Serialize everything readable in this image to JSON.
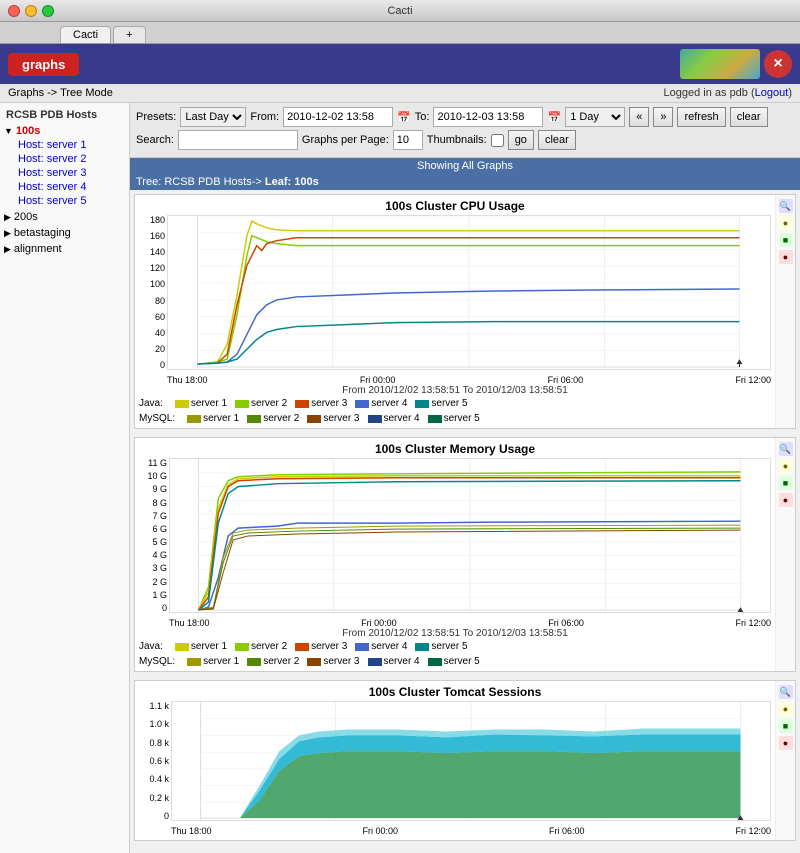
{
  "window": {
    "title": "Cacti",
    "tab_label": "Cacti"
  },
  "topbar": {
    "graphs_btn": "graphs",
    "logo_alt": "Cacti logo"
  },
  "navbar": {
    "path": "Graphs -> Tree Mode",
    "logged_in_label": "Logged in as pdb",
    "logout_label": "Logout"
  },
  "controls": {
    "presets_label": "Presets:",
    "presets_value": "Last Day",
    "from_label": "From:",
    "from_value": "2010-12-02 13:58",
    "to_label": "To:",
    "to_value": "2010-12-03 13:58",
    "day_value": "1 Day",
    "refresh_btn": "refresh",
    "clear_btn": "clear",
    "search_label": "Search:",
    "graphs_per_page_label": "Graphs per Page:",
    "graphs_per_page_value": "10",
    "thumbnails_label": "Thumbnails:",
    "go_btn": "go",
    "clear2_btn": "clear"
  },
  "status": {
    "showing": "Showing All Graphs"
  },
  "breadcrumb": {
    "tree": "Tree: RCSB PDB Hosts->",
    "leaf": "Leaf: 100s"
  },
  "sidebar": {
    "title": "RCSB PDB Hosts",
    "groups": [
      {
        "name": "100s",
        "expanded": true,
        "items": [
          "Host: server 1",
          "Host: server 2",
          "Host: server 3",
          "Host: server 4",
          "Host: server 5"
        ]
      },
      {
        "name": "200s",
        "expanded": false,
        "items": []
      },
      {
        "name": "betastaging",
        "expanded": false,
        "items": []
      },
      {
        "name": "alignment",
        "expanded": false,
        "items": []
      }
    ]
  },
  "graphs": [
    {
      "title": "100s Cluster CPU Usage",
      "time_label": "From 2010/12/02 13:58:51 To 2010/12/03 13:58:51",
      "x_labels": [
        "Thu 18:00",
        "Fri 00:00",
        "Fri 06:00",
        "Fri 12:00"
      ],
      "y_labels": [
        "0",
        "20",
        "40",
        "60",
        "80",
        "100",
        "120",
        "140",
        "160",
        "180"
      ],
      "legend_java": [
        {
          "label": "server 1",
          "color": "#cccc00"
        },
        {
          "label": "server 2",
          "color": "#88cc00"
        },
        {
          "label": "server 3",
          "color": "#cc4400"
        },
        {
          "label": "server 4",
          "color": "#4466cc"
        },
        {
          "label": "server 5",
          "color": "#008888"
        }
      ],
      "legend_mysql": [
        {
          "label": "server 1",
          "color": "#999900"
        },
        {
          "label": "server 2",
          "color": "#558800"
        },
        {
          "label": "server 3",
          "color": "#884400"
        },
        {
          "label": "server 4",
          "color": "#224488"
        },
        {
          "label": "server 5",
          "color": "#006644"
        }
      ]
    },
    {
      "title": "100s Cluster Memory Usage",
      "time_label": "From 2010/12/02 13:58:51 To 2010/12/03 13:58:51",
      "x_labels": [
        "Thu 18:00",
        "Fri 00:00",
        "Fri 06:00",
        "Fri 12:00"
      ],
      "y_labels": [
        "0",
        "1 G",
        "2 G",
        "3 G",
        "4 G",
        "5 G",
        "6 G",
        "7 G",
        "8 G",
        "9 G",
        "10 G",
        "11 G"
      ],
      "legend_java": [
        {
          "label": "server 1",
          "color": "#cccc00"
        },
        {
          "label": "server 2",
          "color": "#88cc00"
        },
        {
          "label": "server 3",
          "color": "#cc4400"
        },
        {
          "label": "server 4",
          "color": "#4466cc"
        },
        {
          "label": "server 5",
          "color": "#008888"
        }
      ],
      "legend_mysql": [
        {
          "label": "server 1",
          "color": "#999900"
        },
        {
          "label": "server 2",
          "color": "#558800"
        },
        {
          "label": "server 3",
          "color": "#884400"
        },
        {
          "label": "server 4",
          "color": "#224488"
        },
        {
          "label": "server 5",
          "color": "#006644"
        }
      ]
    },
    {
      "title": "100s Cluster Tomcat Sessions",
      "x_labels": [
        "Thu 18:00",
        "Fri 00:00",
        "Fri 06:00",
        "Fri 12:00"
      ],
      "y_labels": [
        "0",
        "0.2 k",
        "0.4 k",
        "0.6 k",
        "0.8 k",
        "1.0 k",
        "1.1 k"
      ]
    }
  ],
  "icons": {
    "zoom": "🔍",
    "info": "i",
    "report": "📊",
    "edit": "✎",
    "arrow_right": "▶",
    "arrow_down": "▼",
    "arrow_fwd": "»",
    "arrow_back": "«"
  }
}
